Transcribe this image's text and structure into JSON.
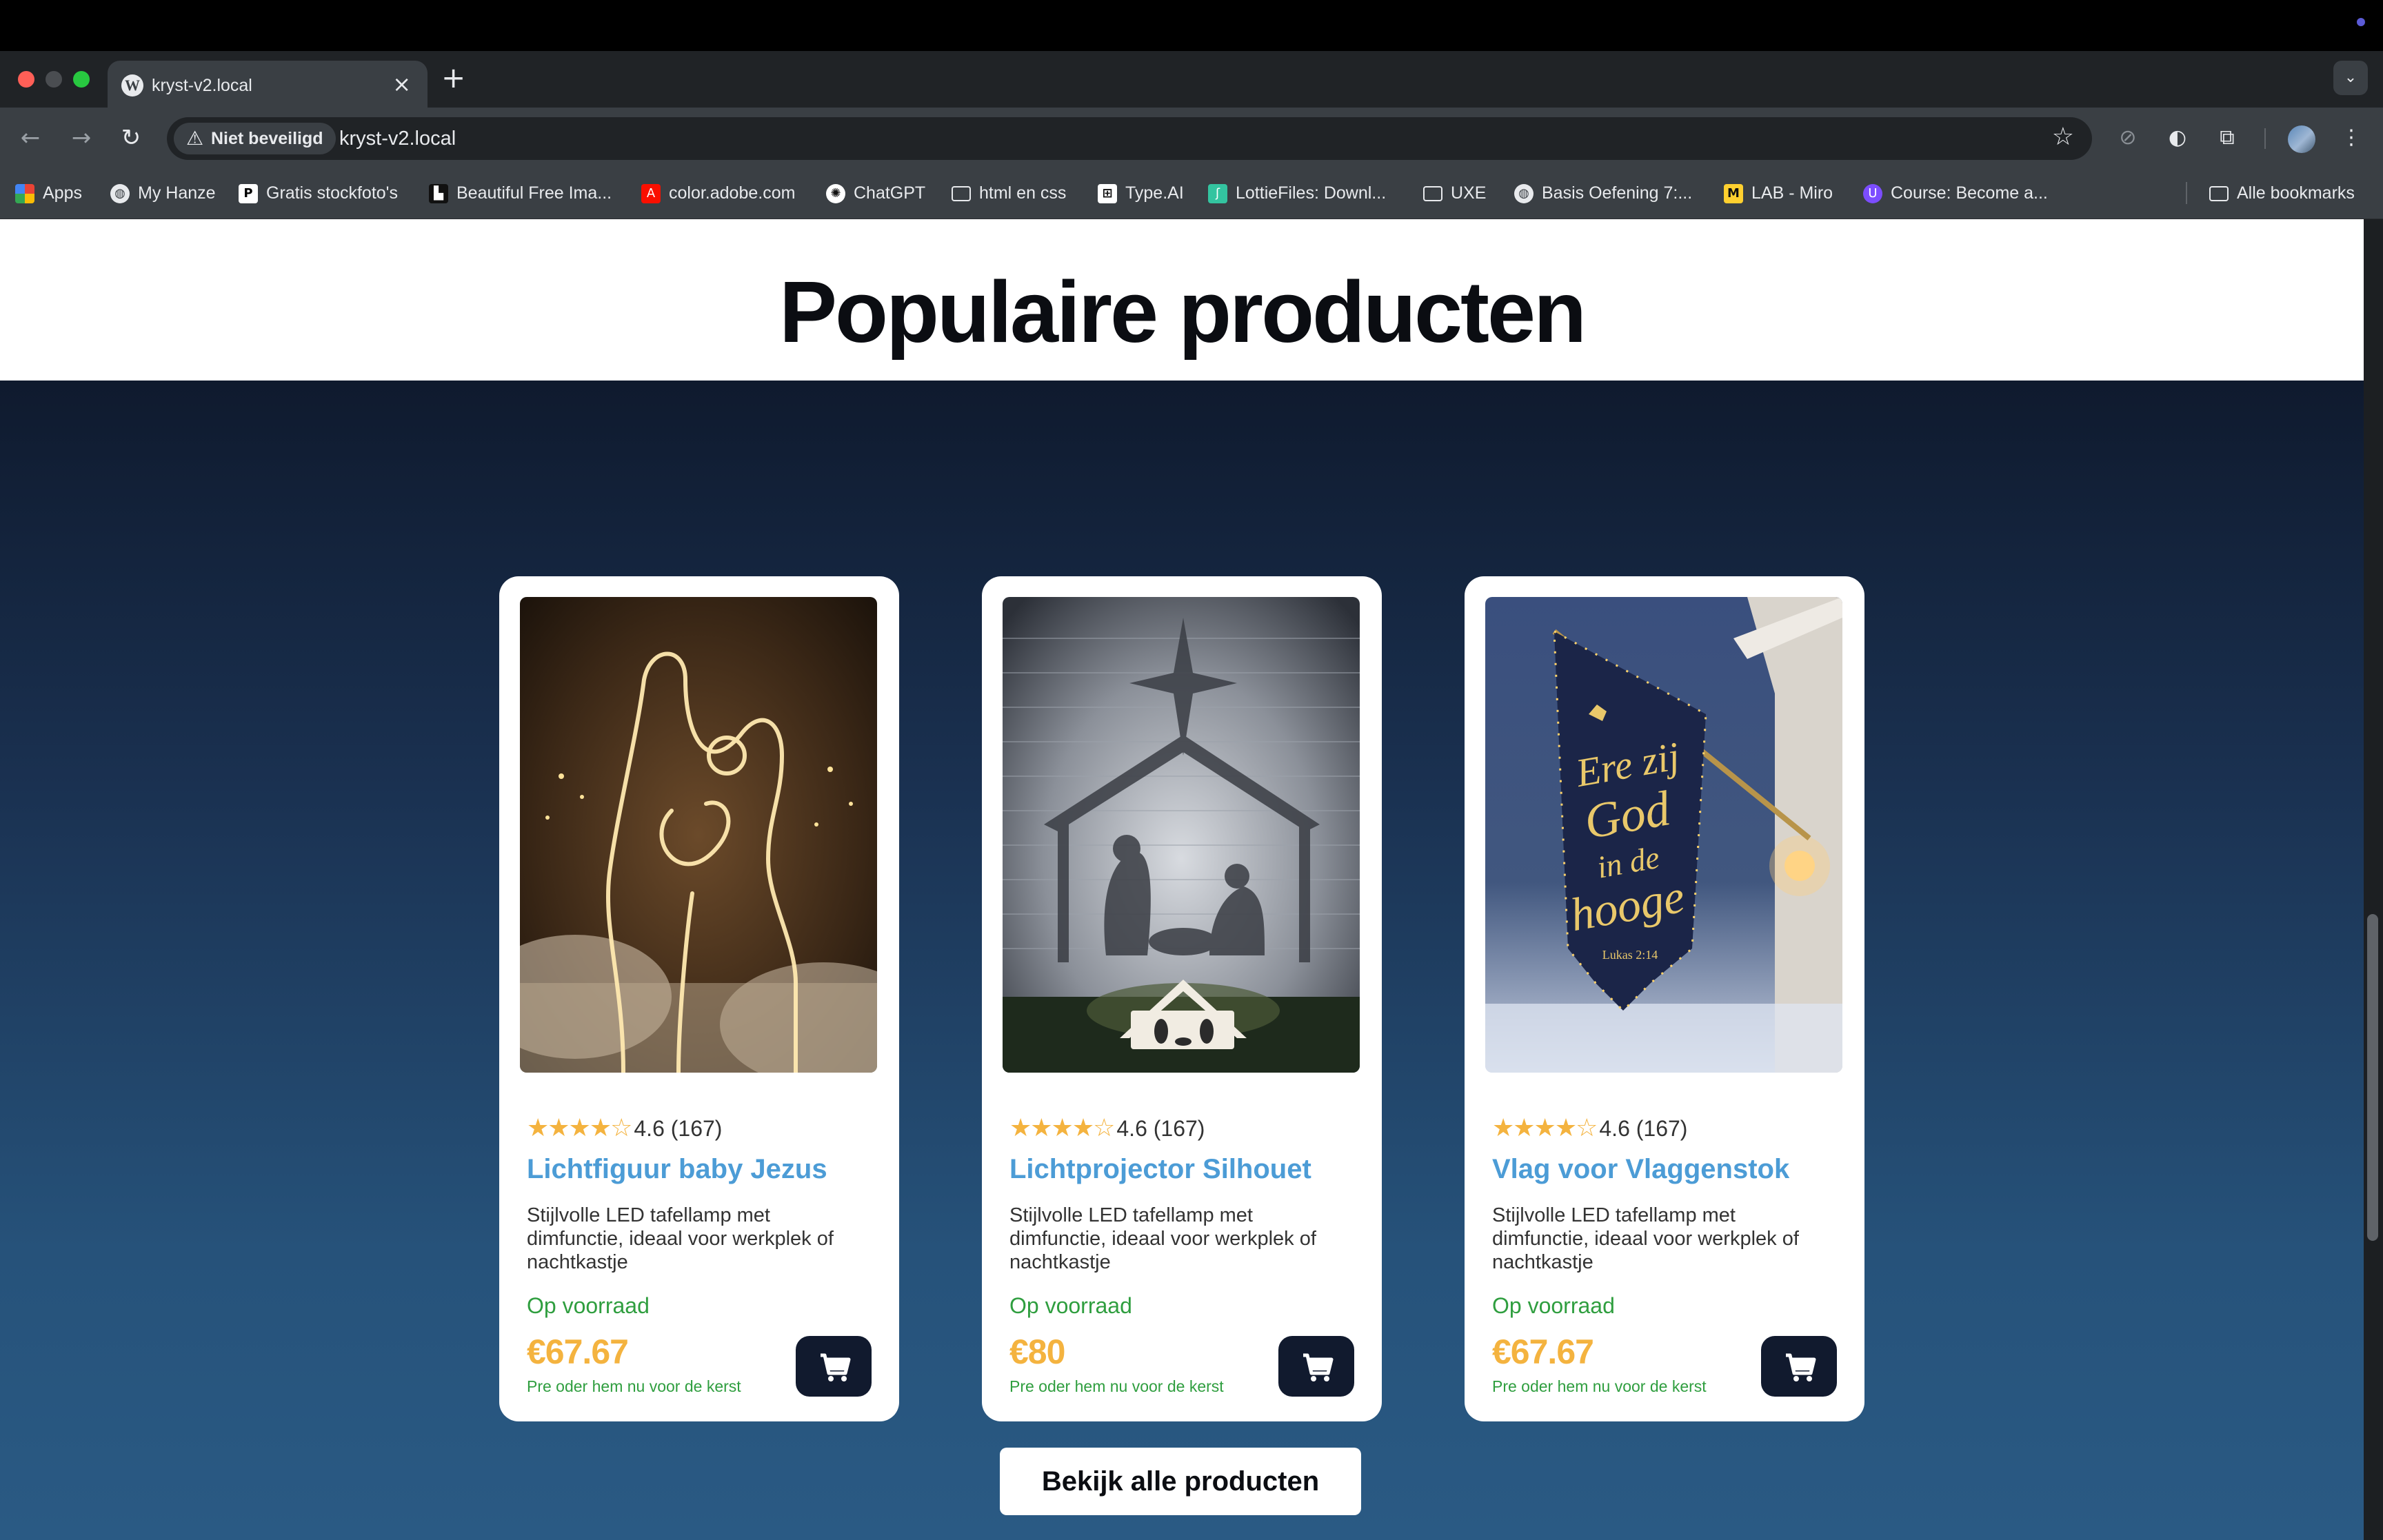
{
  "browser": {
    "tab_title": "kryst-v2.local",
    "tab_close": "×",
    "new_tab": "+",
    "security_label": "Niet beveiligd",
    "url": "kryst-v2.local",
    "bookmarks": [
      {
        "label": "Apps",
        "icon": "apps-grid-icon"
      },
      {
        "label": "My Hanze",
        "icon": "globe-icon"
      },
      {
        "label": "Gratis stockfoto's",
        "icon": "pexels-icon"
      },
      {
        "label": "Beautiful Free Ima...",
        "icon": "unsplash-icon"
      },
      {
        "label": "color.adobe.com",
        "icon": "adobe-icon"
      },
      {
        "label": "ChatGPT",
        "icon": "chatgpt-icon"
      },
      {
        "label": "html en css",
        "icon": "folder-icon"
      },
      {
        "label": "Type.AI",
        "icon": "typeai-icon"
      },
      {
        "label": "LottieFiles: Downl...",
        "icon": "lottie-icon"
      },
      {
        "label": "UXE",
        "icon": "folder-icon"
      },
      {
        "label": "Basis Oefening 7:...",
        "icon": "globe-icon"
      },
      {
        "label": "LAB - Miro",
        "icon": "miro-icon"
      },
      {
        "label": "Course: Become a...",
        "icon": "course-icon"
      }
    ],
    "all_bookmarks": "Alle bookmarks"
  },
  "page": {
    "heading": "Populaire producten",
    "view_all_label": "Bekijk alle producten"
  },
  "products": [
    {
      "stars": "★★★★☆",
      "rating": "4.6 (167)",
      "title": "Lichtfiguur baby Jezus",
      "description": "Stijlvolle LED tafellamp met dimfunctie, ideaal voor werkplek of nachtkastje",
      "stock": "Op voorraad",
      "price": "€67.67",
      "preorder": "Pre oder hem nu voor de kerst"
    },
    {
      "stars": "★★★★☆",
      "rating": "4.6 (167)",
      "title": "Lichtprojector Silhouet",
      "description": "Stijlvolle LED tafellamp met dimfunctie, ideaal voor werkplek of nachtkastje",
      "stock": "Op voorraad",
      "price": "€80",
      "preorder": "Pre oder hem nu voor de kerst"
    },
    {
      "stars": "★★★★☆",
      "rating": "4.6 (167)",
      "title": "Vlag voor Vlaggenstok",
      "description": "Stijlvolle LED tafellamp met dimfunctie, ideaal voor werkplek of nachtkastje",
      "stock": "Op voorraad",
      "price": "€67.67",
      "preorder": "Pre oder hem nu voor de kerst"
    }
  ],
  "flag_text": {
    "line1": "Ere zij",
    "line2": "God",
    "line3": "in de",
    "line4": "hooge",
    "verse": "Lukas 2:14"
  },
  "colors": {
    "accent_title": "#4c9cd6",
    "price": "#f4b33f",
    "stock": "#2f9e3f",
    "cart_button": "#111a2e",
    "section_bg_top": "#0f1a2e",
    "section_bg_bottom": "#2a5a84"
  }
}
